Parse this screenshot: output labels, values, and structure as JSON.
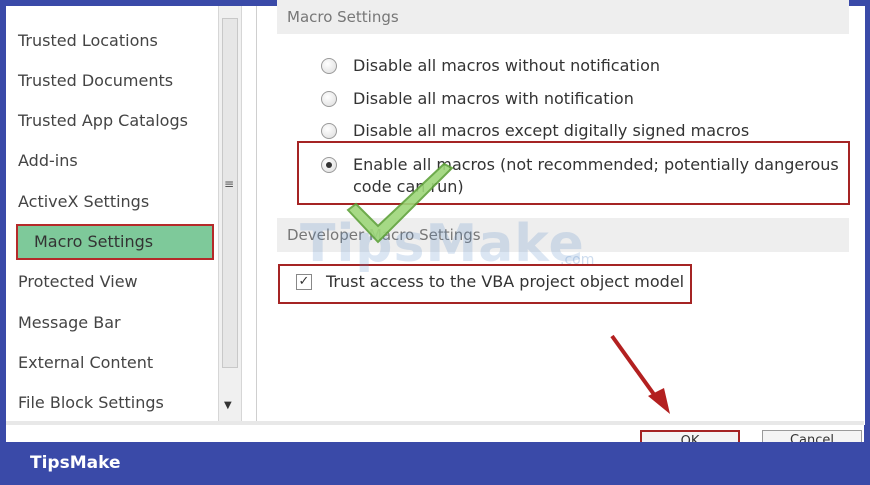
{
  "sidebar": {
    "items": [
      {
        "label": "Trusted Locations"
      },
      {
        "label": "Trusted Documents"
      },
      {
        "label": "Trusted App Catalogs"
      },
      {
        "label": "Add-ins"
      },
      {
        "label": "ActiveX Settings"
      },
      {
        "label": "Macro Settings",
        "selected": true
      },
      {
        "label": "Protected View"
      },
      {
        "label": "Message Bar"
      },
      {
        "label": "External Content"
      },
      {
        "label": "File Block Settings"
      }
    ]
  },
  "main": {
    "macro_section_title": "Macro Settings",
    "macro_options": [
      {
        "label": "Disable all macros without notification",
        "selected": false
      },
      {
        "label": "Disable all macros with notification",
        "selected": false
      },
      {
        "label": "Disable all macros except digitally signed macros",
        "selected": false
      },
      {
        "label": "Enable all macros (not recommended; potentially dangerous",
        "label_line2": "code can run)",
        "selected": true
      }
    ],
    "developer_section_title": "Developer Macro Settings",
    "trust_vba_label": "Trust access to the VBA project object model",
    "trust_vba_checked": true,
    "trust_vba_check_glyph": "✓"
  },
  "buttons": {
    "ok_label": "OK",
    "cancel_label": "Cancel"
  },
  "watermark": {
    "text": "TipsMake",
    "suffix": ".com"
  },
  "footer": {
    "brand": "TipsMake"
  },
  "colors": {
    "frame_blue": "#3a4aa8",
    "selected_green": "#7ec99a",
    "annotation_red": "#a52424",
    "checkmark_green": "#7fc45a"
  }
}
